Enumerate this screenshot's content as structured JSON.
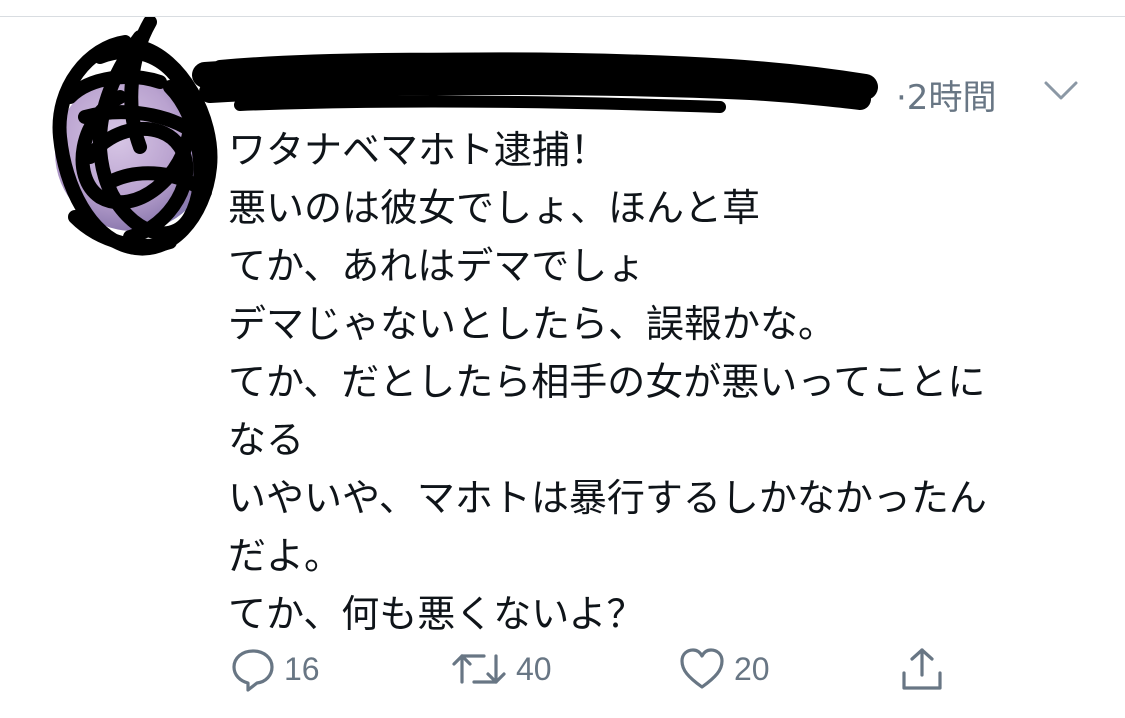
{
  "tweet": {
    "display_name": "",
    "ellipsis": "...",
    "timestamp": "·2時間",
    "lines": [
      "ワタナベマホト逮捕！",
      "悪いのは彼女でしょ、ほんと草",
      "てか、あれはデマでしょ",
      "デマじゃないとしたら、誤報かな。",
      "てか、だとしたら相手の女が悪いってことに",
      "なる",
      "いやいや、マホトは暴行するしかなかったん",
      "だよ。",
      "てか、何も悪くないよ？"
    ],
    "actions": {
      "reply_count": "16",
      "retweet_count": "40",
      "like_count": "20"
    }
  },
  "colors": {
    "text": "#0f1419",
    "secondary": "#687684",
    "divider": "#d9dde1"
  },
  "icons": {
    "caret": "chevron-down-icon",
    "reply": "reply-icon",
    "retweet": "retweet-icon",
    "like": "heart-icon",
    "share": "share-icon"
  }
}
